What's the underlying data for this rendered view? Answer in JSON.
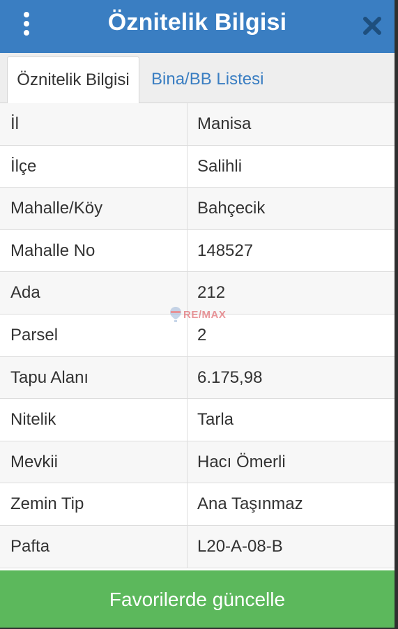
{
  "header": {
    "title": "Öznitelik Bilgisi"
  },
  "tabs": [
    {
      "label": "Öznitelik Bilgisi",
      "active": true
    },
    {
      "label": "Bina/BB Listesi",
      "active": false
    }
  ],
  "rows": [
    {
      "label": "İl",
      "value": "Manisa"
    },
    {
      "label": "İlçe",
      "value": "Salihli"
    },
    {
      "label": "Mahalle/Köy",
      "value": "Bahçecik"
    },
    {
      "label": "Mahalle No",
      "value": "148527"
    },
    {
      "label": "Ada",
      "value": "212"
    },
    {
      "label": "Parsel",
      "value": "2"
    },
    {
      "label": "Tapu Alanı",
      "value": "6.175,98"
    },
    {
      "label": "Nitelik",
      "value": "Tarla"
    },
    {
      "label": "Mevkii",
      "value": "Hacı Ömerli"
    },
    {
      "label": "Zemin Tip",
      "value": "Ana Taşınmaz"
    },
    {
      "label": "Pafta",
      "value": "L20-A-08-B"
    }
  ],
  "watermark": {
    "text": "RE/MAX"
  },
  "action": {
    "label": "Favorilerde güncelle"
  },
  "colors": {
    "header": "#3a7ec2",
    "tab_link": "#3a7ec2",
    "action_button": "#5cb85c",
    "close_icon": "#1e4f7e"
  },
  "icons": {
    "menu": "kebab-menu-icon",
    "close": "close-icon",
    "watermark": "balloon-logo-icon"
  }
}
